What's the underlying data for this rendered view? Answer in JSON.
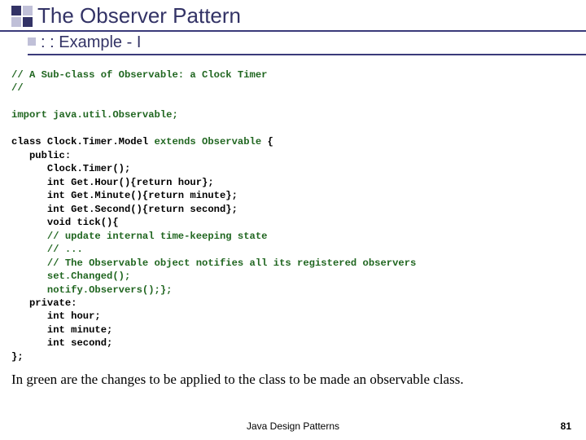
{
  "header": {
    "title": "The Observer Pattern",
    "subtitle": ": : Example - I"
  },
  "code": {
    "c1": "// A Sub-class of Observable: a Clock Timer",
    "c2": "//",
    "c3": "import java.util.Observable;",
    "c4": "class Clock.Timer.Model ",
    "c4b": "extends Observable",
    "c4c": " {",
    "c5": "   public:",
    "c6": "      Clock.Timer();",
    "c7": "      int Get.Hour(){return hour};",
    "c8": "      int Get.Minute(){return minute};",
    "c9": "      int Get.Second(){return second};",
    "c10": "      void tick(){",
    "c11": "      // update internal time-keeping state",
    "c12": "      // ...",
    "c13": "      // The Observable object notifies all its registered observers",
    "c14": "      set.Changed();",
    "c15": "      notify.Observers();};",
    "c16": "   private:",
    "c17": "      int hour;",
    "c18": "      int minute;",
    "c19": "      int second;",
    "c20": "};"
  },
  "caption": "In green are the changes to be applied to the class to be made an observable class.",
  "footer": {
    "center": "Java Design Patterns",
    "page": "81"
  }
}
